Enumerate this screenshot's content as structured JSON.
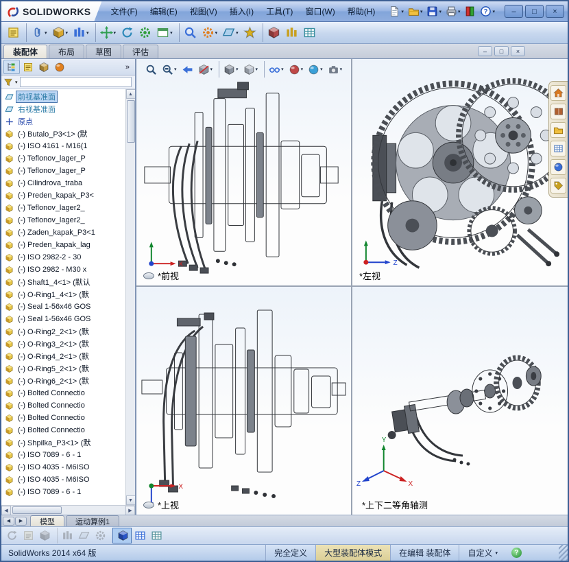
{
  "titlebar": {
    "brand": "SOLIDWORKS",
    "tools": [
      {
        "name": "new-document-button",
        "sym": "page",
        "color": "#5a6fae",
        "caret": true
      },
      {
        "name": "open-button",
        "sym": "folder",
        "color": "#e8b93a",
        "caret": true
      },
      {
        "name": "save-button",
        "sym": "disk",
        "color": "#2a56c8",
        "caret": true
      },
      {
        "name": "print-button",
        "sym": "printer",
        "color": "#8a94a4",
        "caret": true
      },
      {
        "name": "display-toggle-button",
        "sym": "toggle",
        "color": "#c03030"
      },
      {
        "name": "help-button",
        "sym": "help",
        "color": "#2255bb",
        "caret": true
      }
    ],
    "window_buttons": [
      {
        "name": "minimize-button",
        "glyph": "–"
      },
      {
        "name": "maximize-button",
        "glyph": "□"
      },
      {
        "name": "close-button",
        "glyph": "×"
      }
    ]
  },
  "menubar": {
    "items": [
      {
        "label": "文件(F)",
        "name": "menu-file"
      },
      {
        "label": "编辑(E)",
        "name": "menu-edit"
      },
      {
        "label": "视图(V)",
        "name": "menu-view"
      },
      {
        "label": "插入(I)",
        "name": "menu-insert"
      },
      {
        "label": "工具(T)",
        "name": "menu-tools"
      },
      {
        "label": "窗口(W)",
        "name": "menu-window"
      },
      {
        "label": "帮助(H)",
        "name": "menu-help"
      }
    ]
  },
  "assembly_toolbar": {
    "icons": [
      {
        "name": "comment-icon",
        "sym": "note",
        "color": "#d8b83a"
      },
      {
        "name": "mate-icon",
        "sym": "paperclip",
        "color": "#4a78c0",
        "caret": true,
        "classes": [
          "group-start"
        ]
      },
      {
        "name": "insert-component-icon",
        "sym": "cube",
        "color": "#d8a830",
        "caret": true
      },
      {
        "name": "linear-pattern-icon",
        "sym": "columns",
        "color": "#3a6fd8",
        "caret": true
      },
      {
        "name": "move-component-icon",
        "sym": "move",
        "color": "#2f9e50",
        "caret": true,
        "classes": [
          "group-start"
        ]
      },
      {
        "name": "rotate-component-icon",
        "sym": "rotate",
        "color": "#2a88b8"
      },
      {
        "name": "smart-fasteners-icon",
        "sym": "gear",
        "color": "#2f9e3a"
      },
      {
        "name": "new-window-icon",
        "sym": "window",
        "color": "#4a9a5a",
        "caret": true
      },
      {
        "name": "show-hidden-components-icon",
        "sym": "magnifier",
        "color": "#3a6fd8",
        "classes": [
          "group-start"
        ]
      },
      {
        "name": "assembly-features-icon",
        "sym": "gear",
        "color": "#e07f20",
        "caret": true
      },
      {
        "name": "reference-geometry-icon",
        "sym": "plane",
        "color": "#2e7da8",
        "caret": true
      },
      {
        "name": "smart-components-icon",
        "sym": "star",
        "color": "#d8b020"
      },
      {
        "name": "interference-detection-icon",
        "sym": "cube",
        "color": "#b04848",
        "classes": [
          "group-start"
        ]
      },
      {
        "name": "measure-icon",
        "sym": "columns",
        "color": "#c8a020"
      },
      {
        "name": "bill-of-materials-icon",
        "sym": "grid",
        "color": "#3a8fa0"
      }
    ]
  },
  "command_tabs": {
    "tabs": [
      {
        "label": "装配体",
        "name": "tab-assembly",
        "classes": [
          "active"
        ]
      },
      {
        "label": "布局",
        "name": "tab-layout"
      },
      {
        "label": "草图",
        "name": "tab-sketch"
      },
      {
        "label": "评估",
        "name": "tab-evaluate"
      }
    ],
    "doc_buttons": [
      {
        "name": "doc-minimize-button",
        "glyph": "–"
      },
      {
        "name": "doc-restore-button",
        "glyph": "□"
      },
      {
        "name": "doc-close-button",
        "glyph": "×"
      }
    ]
  },
  "left_panel": {
    "chevron": "»",
    "tabs": [
      {
        "name": "featuremanager-tab-icon",
        "sym": "tree",
        "color": "#2a8a3a",
        "classes": [
          "active"
        ]
      },
      {
        "name": "propertymanager-tab-icon",
        "sym": "note",
        "color": "#d8b83a"
      },
      {
        "name": "configurationmanager-tab-icon",
        "sym": "cube",
        "color": "#c8a048"
      },
      {
        "name": "displaymanager-tab-icon",
        "sym": "ball",
        "color": "#e08020"
      }
    ],
    "filter": {
      "value": ""
    },
    "tree": {
      "items": [
        {
          "sym": "plane",
          "color": "#2e7da8",
          "label": "前视基准面",
          "name": "tree-item-front-plane",
          "classes": [
            "selected"
          ]
        },
        {
          "sym": "plane",
          "color": "#2e7da8",
          "label": "右视基准面",
          "name": "tree-item-right-plane"
        },
        {
          "sym": "origin",
          "color": "#2244aa",
          "label": "原点",
          "name": "tree-item-origin"
        },
        {
          "sym": "part",
          "label": "(-) Butalo_P3<1> (默",
          "name": "tree-item-component"
        },
        {
          "sym": "part",
          "label": "(-) ISO 4161 - M16(1",
          "name": "tree-item-component"
        },
        {
          "sym": "part",
          "label": "(-) Teflonov_lager_P",
          "name": "tree-item-component"
        },
        {
          "sym": "part",
          "label": "(-) Teflonov_lager_P",
          "name": "tree-item-component"
        },
        {
          "sym": "part",
          "label": "(-) Cilindrova_traba",
          "name": "tree-item-component"
        },
        {
          "sym": "part",
          "label": "(-) Preden_kapak_P3<",
          "name": "tree-item-component"
        },
        {
          "sym": "part",
          "label": "(-) Teflonov_lager2_",
          "name": "tree-item-component"
        },
        {
          "sym": "part",
          "label": "(-) Teflonov_lager2_",
          "name": "tree-item-component"
        },
        {
          "sym": "part",
          "label": "(-) Zaden_kapak_P3<1",
          "name": "tree-item-component"
        },
        {
          "sym": "part",
          "label": "(-) Preden_kapak_lag",
          "name": "tree-item-component"
        },
        {
          "sym": "part",
          "label": "(-) ISO 2982-2 - 30",
          "name": "tree-item-component"
        },
        {
          "sym": "part",
          "label": "(-) ISO 2982 - M30 x",
          "name": "tree-item-component"
        },
        {
          "sym": "part",
          "label": "(-) Shaft1_4<1> (默认",
          "name": "tree-item-component"
        },
        {
          "sym": "part",
          "label": "(-) O-Ring1_4<1> (默",
          "name": "tree-item-component"
        },
        {
          "sym": "part",
          "label": "(-) Seal 1-56x46 GOS",
          "name": "tree-item-component"
        },
        {
          "sym": "part",
          "label": "(-) Seal 1-56x46 GOS",
          "name": "tree-item-component"
        },
        {
          "sym": "part",
          "label": "(-) O-Ring2_2<1> (默",
          "name": "tree-item-component"
        },
        {
          "sym": "part",
          "label": "(-) O-Ring3_2<1> (默",
          "name": "tree-item-component"
        },
        {
          "sym": "part",
          "label": "(-) O-Ring4_2<1> (默",
          "name": "tree-item-component"
        },
        {
          "sym": "part",
          "label": "(-) O-Ring5_2<1> (默",
          "name": "tree-item-component"
        },
        {
          "sym": "part",
          "label": "(-) O-Ring6_2<1> (默",
          "name": "tree-item-component"
        },
        {
          "sym": "part",
          "label": "(-) Bolted Connectio",
          "name": "tree-item-component"
        },
        {
          "sym": "part",
          "label": "(-) Bolted Connectio",
          "name": "tree-item-component"
        },
        {
          "sym": "part",
          "label": "(-) Bolted Connectio",
          "name": "tree-item-component"
        },
        {
          "sym": "part",
          "label": "(-) Bolted Connectio",
          "name": "tree-item-component"
        },
        {
          "sym": "part",
          "label": "(-) Shpilka_P3<1> (默",
          "name": "tree-item-component"
        },
        {
          "sym": "part",
          "label": "(-) ISO 7089 - 6 - 1",
          "name": "tree-item-component"
        },
        {
          "sym": "part",
          "label": "(-) ISO 4035 - M6ISO",
          "name": "tree-item-component"
        },
        {
          "sym": "part",
          "label": "(-) ISO 4035 - M6ISO",
          "name": "tree-item-component"
        },
        {
          "sym": "part",
          "label": "(-) ISO 7089 - 6 - 1",
          "name": "tree-item-component"
        }
      ]
    }
  },
  "headsup_toolbar": {
    "icons": [
      {
        "name": "zoom-fit-icon",
        "sym": "magnifier",
        "color": "#33557a"
      },
      {
        "name": "zoom-area-icon",
        "sym": "magnifier2",
        "color": "#33557a",
        "caret": true
      },
      {
        "name": "previous-view-icon",
        "sym": "arrowL",
        "color": "#3a6fd8"
      },
      {
        "name": "section-view-icon",
        "sym": "section",
        "color": "#8a93a0",
        "caret": true
      },
      {
        "name": "view-orientation-icon",
        "sym": "cube",
        "color": "#8a93a0",
        "caret": true,
        "classes": [
          "group-start"
        ]
      },
      {
        "name": "display-style-icon",
        "sym": "cube",
        "color": "#b8c0cc",
        "caret": true
      },
      {
        "name": "hide-show-items-icon",
        "sym": "glasses",
        "color": "#3a6fd8",
        "caret": true,
        "classes": [
          "group-start"
        ]
      },
      {
        "name": "edit-appearance-icon",
        "sym": "ball",
        "color": "#c04848",
        "caret": true
      },
      {
        "name": "apply-scene-icon",
        "sym": "ball",
        "color": "#3aa0d8",
        "caret": true
      },
      {
        "name": "view-settings-icon",
        "sym": "camera",
        "color": "#707a88",
        "caret": true
      }
    ]
  },
  "task_pane": {
    "icons": [
      {
        "name": "solidworks-resources-icon",
        "sym": "home",
        "color": "#d87820"
      },
      {
        "name": "design-library-icon",
        "sym": "book",
        "color": "#b06030"
      },
      {
        "name": "file-explorer-icon",
        "sym": "folder",
        "color": "#e8b93a"
      },
      {
        "name": "view-palette-icon",
        "sym": "grid",
        "color": "#5580c0"
      },
      {
        "name": "appearances-icon",
        "sym": "ball",
        "color": "#3a6fd8"
      },
      {
        "name": "custom-properties-icon",
        "sym": "tag",
        "color": "#c8a020"
      }
    ]
  },
  "viewports": [
    {
      "label": "*前视",
      "name": "viewport-front"
    },
    {
      "label": "*左视",
      "name": "viewport-left"
    },
    {
      "label": "*上视",
      "name": "viewport-top"
    },
    {
      "label": "*上下二等角轴测",
      "name": "viewport-dimetric"
    }
  ],
  "bottom_tabs": {
    "nav": [
      {
        "name": "tab-scroll-left-button",
        "glyph": "◀"
      },
      {
        "name": "tab-scroll-right-button",
        "glyph": "▶"
      }
    ],
    "tabs": [
      {
        "label": "模型",
        "name": "tab-model",
        "classes": [
          "active"
        ]
      },
      {
        "label": "运动算例1",
        "name": "tab-motion-study"
      }
    ]
  },
  "lower_toolbar": {
    "icons": [
      {
        "name": "view-previous-icon",
        "sym": "rotate",
        "color": "#6a7686",
        "classes": [
          "disabled"
        ]
      },
      {
        "name": "sketch-tool-icon",
        "sym": "note",
        "color": "#6a7686",
        "classes": [
          "disabled"
        ]
      },
      {
        "name": "3d-sketch-icon",
        "sym": "cube",
        "color": "#6a7686",
        "classes": [
          "disabled"
        ]
      },
      {
        "name": "dimension-tool-icon",
        "sym": "columns",
        "color": "#6a7686",
        "classes": [
          "disabled",
          "group-start"
        ]
      },
      {
        "name": "reference-plane-icon",
        "sym": "plane",
        "color": "#6a7686",
        "classes": [
          "disabled"
        ]
      },
      {
        "name": "instant3d-icon",
        "sym": "gear",
        "color": "#6a7686",
        "classes": [
          "disabled"
        ]
      },
      {
        "name": "viewport-active-icon",
        "sym": "cube",
        "color": "#2a56c8",
        "classes": [
          "active",
          "group-start"
        ]
      },
      {
        "name": "four-view-icon",
        "sym": "grid",
        "color": "#3a6fd8"
      },
      {
        "name": "display-grid-icon",
        "sym": "grid",
        "color": "#50909a"
      }
    ]
  },
  "status_bar": {
    "left_text": "SolidWorks 2014 x64 版",
    "segments": [
      {
        "label": "完全定义",
        "name": "status-fully-defined"
      },
      {
        "label": "大型装配体模式",
        "name": "status-large-assembly-mode",
        "classes": [
          "warn"
        ]
      },
      {
        "label": "在编辑 装配体",
        "name": "status-editing-assembly"
      },
      {
        "label": "自定义",
        "name": "status-custom-menu",
        "caret": true
      }
    ],
    "help_glyph": "?"
  }
}
